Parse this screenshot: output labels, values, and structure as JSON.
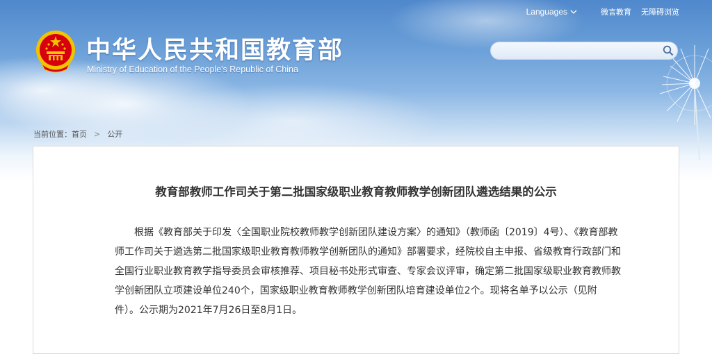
{
  "header": {
    "languages_label": "Languages",
    "links": [
      "微言教育",
      "无障碍浏览"
    ],
    "title_cn": "中华人民共和国教育部",
    "title_en": "Ministry of Education of the People's Republic of China",
    "search_placeholder": "",
    "icons": [
      "national-emblem-icon",
      "chevron-down-icon",
      "search-icon"
    ]
  },
  "breadcrumb": {
    "prefix": "当前位置：",
    "items": [
      "首页",
      "公开"
    ],
    "separator": ">"
  },
  "article": {
    "title": "教育部教师工作司关于第二批国家级职业教育教师教学创新团队遴选结果的公示",
    "body": "根据《教育部关于印发〈全国职业院校教师教学创新团队建设方案〉的通知》（教师函〔2019〕4号）、《教育部教师工作司关于遴选第二批国家级职业教育教师教学创新团队的通知》部署要求，经院校自主申报、省级教育行政部门和全国行业职业教育教学指导委员会审核推荐、项目秘书处形式审查、专家会议评审，确定第二批国家级职业教育教师教学创新团队立项建设单位240个，国家级职业教育教师教学创新团队培育建设单位2个。现将名单予以公示（见附件）。公示期为2021年7月26日至8月1日。"
  },
  "colors": {
    "sky_top": "#4f88cc",
    "emblem_red": "#d7000f",
    "emblem_gold": "#f2c300",
    "text": "#333333"
  }
}
